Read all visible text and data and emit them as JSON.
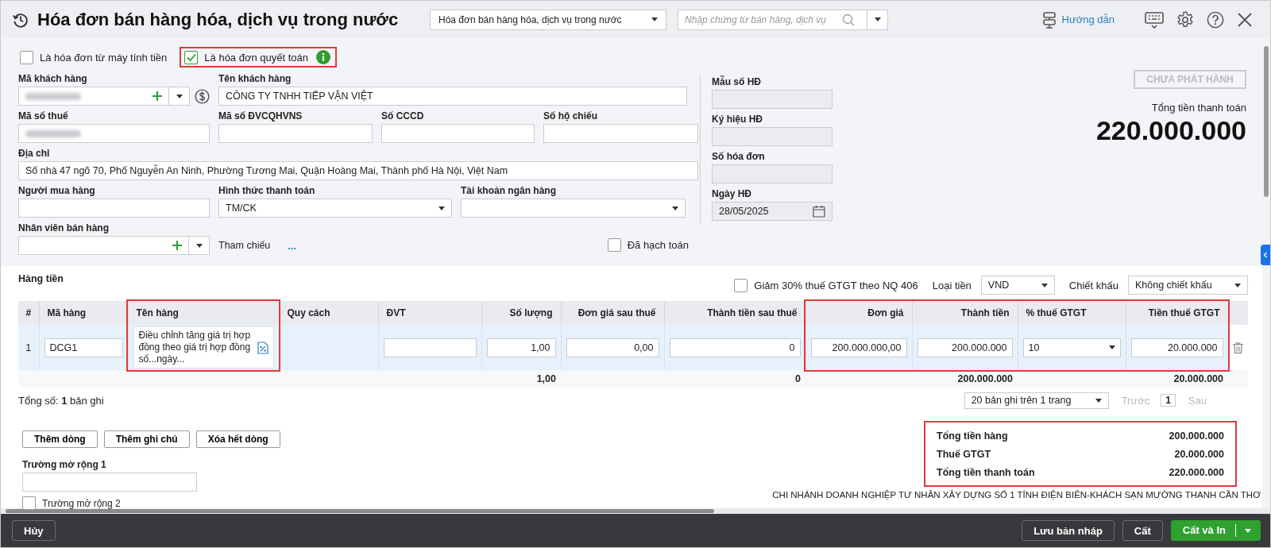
{
  "header": {
    "title": "Hóa đơn bán hàng hóa, dịch vụ trong nước",
    "form_select": {
      "value": "Hóa đơn bán hàng hóa, dịch vụ trong nước"
    },
    "search": {
      "placeholder": "Nhập chứng từ bán hàng, dịch vụ"
    },
    "guide_link": "Hướng dẫn"
  },
  "options": [
    {
      "label": "Là hóa đơn từ máy tính tiền",
      "checked": false,
      "highlighted": false,
      "info": false
    },
    {
      "label": "Là hóa đơn quyết toán",
      "checked": true,
      "highlighted": true,
      "info": true
    }
  ],
  "form": {
    "rows": [
      [
        {
          "kind": "customer",
          "label": "Mã khách hàng",
          "redacted": true
        },
        {
          "kind": "text",
          "label": "Tên khách hàng",
          "value": "CÔNG TY TNHH TIẾP VẬN VIỆT"
        }
      ],
      [
        {
          "kind": "text",
          "label": "Mã số thuế",
          "redacted": true
        },
        {
          "kind": "text",
          "label": "Mã số ĐVCQHVNS"
        },
        {
          "kind": "text",
          "label": "Số CCCD"
        },
        {
          "kind": "text",
          "label": "Số hộ chiếu"
        }
      ],
      [
        {
          "kind": "text",
          "label": "Địa chỉ",
          "value": "Số nhà 47 ngõ 70, Phố Nguyễn An Ninh, Phường Tương Mai, Quận Hoàng Mai, Thành phố Hà Nội, Việt Nam"
        }
      ],
      [
        {
          "kind": "text",
          "label": "Người mua hàng"
        },
        {
          "kind": "select",
          "label": "Hình thức thanh toán",
          "value": "TM/CK"
        },
        {
          "kind": "select",
          "label": "Tài khoản ngân hàng"
        }
      ],
      [
        {
          "kind": "combo",
          "label": "Nhân viên bán hàng"
        },
        {
          "kind": "reference",
          "label": "Tham chiếu",
          "value": "..."
        },
        {
          "kind": "checkbox",
          "label": "Đã hạch toán",
          "checked": false
        }
      ]
    ],
    "invoice": [
      {
        "kind": "text",
        "label": "Mẫu số HĐ",
        "disabled": true
      },
      {
        "kind": "text",
        "label": "Ký hiệu HĐ",
        "disabled": true
      },
      {
        "kind": "text",
        "label": "Số hóa đơn",
        "disabled": true
      },
      {
        "kind": "date",
        "label": "Ngày HĐ",
        "value": "28/05/2025",
        "disabled": true
      }
    ],
    "status": {
      "label": "CHƯA PHÁT HÀNH",
      "disabled": true
    },
    "total_label": "Tổng tiền thanh toán",
    "total_amount": "220.000.000"
  },
  "items": {
    "title": "Hàng tiền",
    "reduce_vat": {
      "label": "Giảm 30% thuế GTGT theo NQ 406",
      "checked": false
    },
    "currency": {
      "label": "Loại tiền",
      "value": "VND"
    },
    "discount": {
      "label": "Chiết khấu",
      "value": "Không chiết khấu"
    },
    "columns": [
      {
        "label": "#",
        "kind": "index",
        "highlighted": false
      },
      {
        "label": "Mã hàng",
        "kind": "text",
        "highlighted": false
      },
      {
        "label": "Tên hàng",
        "kind": "text",
        "highlighted": true
      },
      {
        "label": "Quy cách",
        "kind": "text",
        "highlighted": false
      },
      {
        "label": "ĐVT",
        "kind": "text",
        "highlighted": false
      },
      {
        "label": "Số lượng",
        "kind": "number",
        "highlighted": false,
        "total": "1,00"
      },
      {
        "label": "Đơn giá sau thuế",
        "kind": "number",
        "highlighted": false
      },
      {
        "label": "Thành tiền sau thuế",
        "kind": "number",
        "highlighted": false,
        "total": "0"
      },
      {
        "label": "Đơn giá",
        "kind": "number",
        "highlighted": true
      },
      {
        "label": "Thành tiền",
        "kind": "number",
        "highlighted": true,
        "total": "200.000.000"
      },
      {
        "label": "% thuế GTGT",
        "kind": "select",
        "highlighted": true
      },
      {
        "label": "Tiền thuế GTGT",
        "kind": "number",
        "highlighted": true,
        "total": "20.000.000"
      }
    ],
    "rows": [
      {
        "selected": true,
        "cells": [
          {
            "kind": "plain",
            "value": "1"
          },
          {
            "kind": "input",
            "value": "DCG1"
          },
          {
            "kind": "note",
            "value": "Điều chỉnh tăng giá trị hợp đồng theo giá trị hợp đồng số...ngày..."
          },
          {
            "kind": "plain"
          },
          {
            "kind": "input"
          },
          {
            "kind": "input",
            "value": "1,00"
          },
          {
            "kind": "input",
            "value": "0,00"
          },
          {
            "kind": "input",
            "value": "0"
          },
          {
            "kind": "input",
            "value": "200.000.000,00"
          },
          {
            "kind": "input",
            "value": "200.000.000"
          },
          {
            "kind": "select",
            "value": "10"
          },
          {
            "kind": "input",
            "value": "20.000.000"
          }
        ]
      }
    ],
    "record_count": "Tổng số: **1** bản ghi",
    "pager": {
      "page_size": "20 bản ghi trên 1 trang",
      "prev": "Trước",
      "page": "1",
      "next": "Sau",
      "prev_disabled": true,
      "next_disabled": true
    },
    "actions": [
      "Thêm dòng",
      "Thêm ghi chú",
      "Xóa hết dòng"
    ],
    "extra_fields": [
      {
        "kind": "text",
        "label": "Trường mở rộng 1"
      },
      {
        "kind": "checkbox",
        "label": "Trường mở rộng 2",
        "checked": false
      }
    ],
    "summary": {
      "highlighted": true,
      "lines": [
        {
          "label": "Tổng tiền hàng",
          "value": "200.000.000"
        },
        {
          "label": "Thuế GTGT",
          "value": "20.000.000"
        },
        {
          "label": "Tổng tiền thanh toán",
          "value": "220.000.000"
        }
      ]
    },
    "company": "CHI NHÁNH DOANH NGHIỆP TƯ NHÂN XÂY DỰNG SỐ 1 TỈNH ĐIỆN BIÊN-KHÁCH SẠN MƯỜNG THANH CẦN THƠ"
  },
  "footer": {
    "left": [
      {
        "label": "Hủy",
        "kind": "plain"
      }
    ],
    "right": [
      {
        "label": "Lưu bản nháp",
        "kind": "plain"
      },
      {
        "label": "Cất",
        "kind": "plain"
      },
      {
        "label": "Cất và In",
        "kind": "primary"
      }
    ]
  }
}
